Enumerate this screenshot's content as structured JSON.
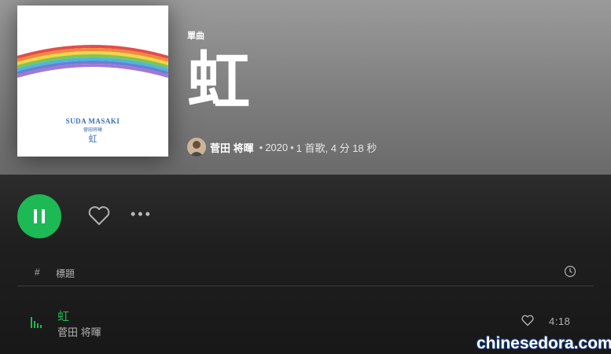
{
  "album": {
    "type_label": "單曲",
    "title": "虹",
    "cover": {
      "artist_text": "SUDA MASAKI",
      "artist_sub": "菅田将暉",
      "title_text": "虹"
    },
    "meta": {
      "artist": "菅田 将暉",
      "year": "2020",
      "summary": "1 首歌, 4 分 18 秒",
      "separator": "•"
    }
  },
  "controls": {
    "play_state": "playing",
    "more_label": "•••"
  },
  "table": {
    "headers": {
      "index": "#",
      "title": "標題"
    },
    "tracks": [
      {
        "title": "虹",
        "artist": "菅田 将暉",
        "duration": "4:18"
      }
    ]
  },
  "watermark": "chinesedora.com",
  "colors": {
    "accent": "#1db954",
    "header_bg": "#888888",
    "body_bg": "#181818"
  },
  "icons": [
    "pause-icon",
    "heart-icon",
    "more-icon",
    "clock-icon",
    "equalizer-icon",
    "heart-icon-small"
  ]
}
